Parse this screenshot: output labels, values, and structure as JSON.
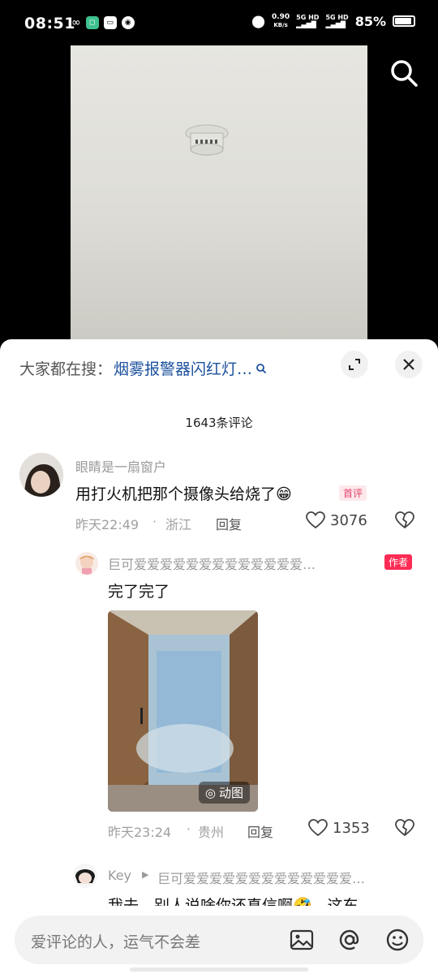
{
  "status": {
    "time": "08:51",
    "speed_top": "0.90",
    "speed_bottom": "KB/s",
    "sim1": "5G HD",
    "sim2": "5G HD",
    "battery": "85%"
  },
  "video": {
    "search_icon": "search-icon"
  },
  "hot_search": {
    "label": "大家都在搜：",
    "query": "烟雾报警器闪红灯…"
  },
  "comments_count": "1643条评论",
  "comments": [
    {
      "name": "眼睛是一扇窗户",
      "text": "用打火机把那个摄像头给烧了😁",
      "badge": "首评",
      "time": "昨天22:49",
      "sep": "·",
      "location": "浙江",
      "reply": "回复",
      "likes": "3076"
    },
    {
      "name": "巨可爱爱爱爱爱爱爱爱爱爱爱爱爱…",
      "badge": "作者",
      "text": "完了完了",
      "gif_label": "动图",
      "time": "昨天23:24",
      "sep": "·",
      "location": "贵州",
      "reply": "回复",
      "likes": "1353"
    },
    {
      "name": "Key",
      "target": "巨可爱爱爱爱爱爱爱爱爱爱爱爱爱…",
      "text": "我去，别人说啥你还真信啊🤣，这东"
    }
  ],
  "input": {
    "placeholder": "爱评论的人，运气不会差"
  },
  "colors": {
    "author_badge": "#fe2c55",
    "link_blue": "#1a4f9c"
  }
}
